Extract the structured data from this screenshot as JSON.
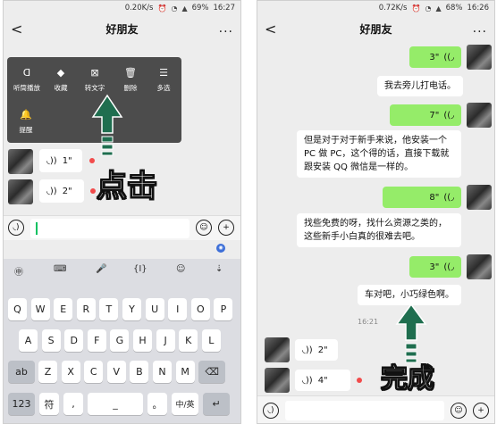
{
  "left_screen": {
    "status": {
      "speed": "0.20K/s",
      "battery": "69%",
      "time": "16:27"
    },
    "nav": {
      "back": "<",
      "title": "好朋友",
      "more": "..."
    },
    "popup": {
      "items": [
        {
          "icon": "ear-icon",
          "label": "听筒播放"
        },
        {
          "icon": "cube-icon",
          "label": "收藏"
        },
        {
          "icon": "convert-text-icon",
          "label": "转文字"
        },
        {
          "icon": "trash-icon",
          "label": "删除"
        },
        {
          "icon": "multiselect-icon",
          "label": "多选"
        },
        {
          "icon": "bell-icon",
          "label": "提醒"
        }
      ]
    },
    "messages": [
      {
        "duration": "1\""
      },
      {
        "duration": "2\""
      }
    ],
    "annotation": "点击",
    "keyboard": {
      "toolbar": [
        "㊥",
        "⌨",
        "🎤",
        "{I}",
        "☺",
        "⇣"
      ],
      "rows": [
        [
          "Q",
          "W",
          "E",
          "R",
          "T",
          "Y",
          "U",
          "I",
          "O",
          "P"
        ],
        [
          "A",
          "S",
          "D",
          "F",
          "G",
          "H",
          "J",
          "K",
          "L"
        ],
        [
          "ab",
          "Z",
          "X",
          "C",
          "V",
          "B",
          "N",
          "M",
          "⌫"
        ]
      ],
      "bottom": [
        "123",
        "符",
        ",",
        "_",
        "。",
        "中/英",
        "↵"
      ]
    }
  },
  "right_screen": {
    "status": {
      "speed": "0.72K/s",
      "battery": "68%",
      "time": "16:26"
    },
    "nav": {
      "back": "<",
      "title": "好朋友",
      "more": "..."
    },
    "messages": [
      {
        "dir": "out",
        "duration": "3\""
      },
      {
        "dir": "text",
        "text": "我去旁儿打电话。"
      },
      {
        "dir": "out",
        "duration": "7\""
      },
      {
        "dir": "text",
        "lines": [
          "但是对于对于新手来说，他安装一个",
          "PC 做 PC，这个得的话，直接下载就",
          "跟安装 QQ 微信是一样的。"
        ]
      },
      {
        "dir": "out",
        "duration": "8\""
      },
      {
        "dir": "text",
        "lines": [
          "找些免费的呀，找什么资源之类的，",
          "这些新手小白真的很难去吧。"
        ]
      },
      {
        "dir": "out",
        "duration": "3\""
      },
      {
        "dir": "text",
        "text": "车对吧，小巧绿色啊。"
      },
      {
        "dir": "time",
        "text": "16:21"
      },
      {
        "dir": "in",
        "duration": "2\""
      },
      {
        "dir": "in",
        "duration": "4\""
      }
    ],
    "annotation": "完成"
  },
  "colors": {
    "bubble_out": "#95ec69",
    "popup_bg": "#4c4c4c",
    "arrow": "#1f6e4f",
    "red_dot": "#f24b4b"
  }
}
